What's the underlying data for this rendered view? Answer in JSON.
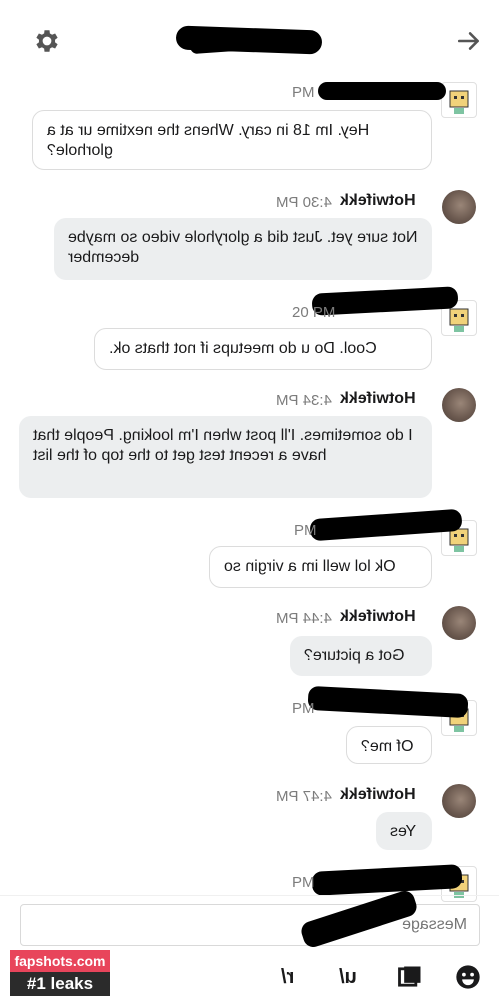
{
  "header": {
    "settings_icon": "gear-icon",
    "back_icon": "arrow-icon"
  },
  "messages": [
    {
      "sender": "",
      "time": "PM",
      "text": "Hey. Im 18 in cary. Whens the nextime ur at a glorhole?",
      "incoming": false
    },
    {
      "sender": "Hotwifekk",
      "time": "4:30 PM",
      "text": "Not sure yet. Just did a gloryhole video so maybe december",
      "incoming": true
    },
    {
      "sender": "",
      "time": "20 PM",
      "text": "Cool. Do u do meetups if not thats ok.",
      "incoming": false
    },
    {
      "sender": "Hotwifekk",
      "time": "4:34 PM",
      "text": "I do sometimes. I'll post when I'm looking. People that have a recent test get to the top of the list",
      "incoming": true
    },
    {
      "sender": "",
      "time": "PM",
      "text": "Ok lol well im a virgin so",
      "incoming": false
    },
    {
      "sender": "Hotwifekk",
      "time": "4:44 PM",
      "text": "Got a picture?",
      "incoming": true
    },
    {
      "sender": "",
      "time": "PM",
      "text": "Of me?",
      "incoming": false
    },
    {
      "sender": "Hotwifekk",
      "time": "4:47 PM",
      "text": "Yes",
      "incoming": true
    },
    {
      "sender": "",
      "time": "PM",
      "text": "",
      "incoming": false
    }
  ],
  "composer": {
    "placeholder": "Message"
  },
  "toolbar": {
    "r_label": "r/",
    "u_label": "u/",
    "image_icon": "image-icon",
    "emoji_icon": "emoji-icon"
  },
  "watermark": {
    "line1": "fapshots.com",
    "line2": "#1 leaks"
  }
}
